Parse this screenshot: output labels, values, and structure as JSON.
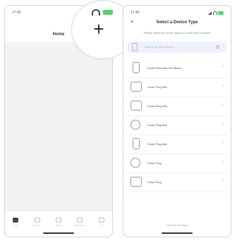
{
  "left": {
    "status_time": "17:43",
    "title": "Home",
    "empty_message": "",
    "tabs": [
      {
        "label": "Home",
        "icon": "home-icon",
        "active": true
      },
      {
        "label": "Devices",
        "icon": "devices-icon",
        "active": false
      },
      {
        "label": "Scenes",
        "icon": "scenes-icon",
        "active": false
      },
      {
        "label": "Automation",
        "icon": "automation-icon",
        "active": false
      },
      {
        "label": "Me",
        "icon": "user-icon",
        "active": false
      }
    ],
    "magnifier": {
      "plus_label": "+"
    }
  },
  "right": {
    "status_time": "17:45",
    "close_label": "×",
    "title": "Select a Device Type",
    "description": "Please select the device type you would like to install.",
    "search_placeholder": "Search for your device...",
    "items": [
      {
        "label": "Smart Essential Oil Diffuser",
        "icon": "diffuser-icon"
      },
      {
        "label": "Smart Plug Mini",
        "icon": "plug-mini-icon"
      },
      {
        "label": "Smart Plug Mini",
        "icon": "plug-mini-icon"
      },
      {
        "label": "Smart Plug Mini",
        "icon": "plug-round-icon"
      },
      {
        "label": "Smart Plug Mini",
        "icon": "plug-tall-icon"
      },
      {
        "label": "Smart Plug",
        "icon": "plug-icon"
      },
      {
        "label": "Smart Plug",
        "icon": "plug-icon"
      }
    ],
    "footer": "Can't find my device"
  },
  "colors": {
    "battery": "#4cd964",
    "search_bg": "#eef2fa",
    "accent": "#98a8d0"
  }
}
